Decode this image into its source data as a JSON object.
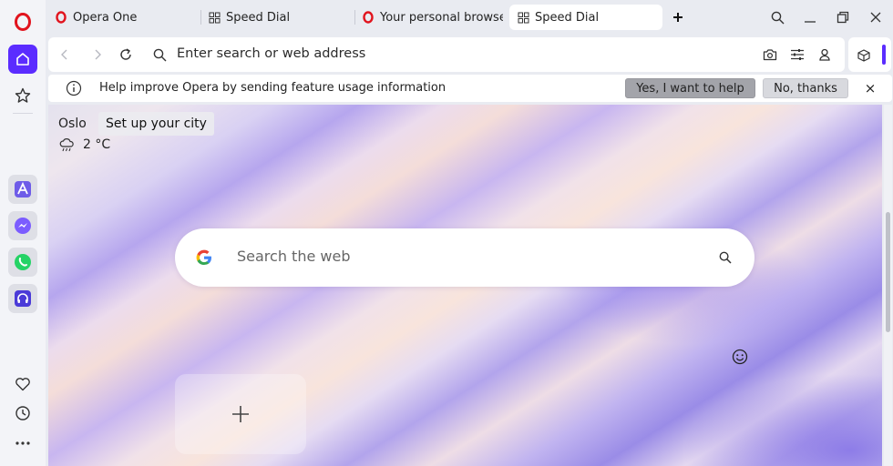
{
  "tabs": [
    {
      "title": "Opera One",
      "icon": "opera-icon"
    },
    {
      "title": "Speed Dial",
      "icon": "speed-dial-icon"
    },
    {
      "title": "Your personal browser",
      "icon": "opera-icon"
    },
    {
      "title": "Speed Dial",
      "icon": "speed-dial-icon",
      "active": true
    }
  ],
  "address_bar": {
    "placeholder": "Enter search or web address"
  },
  "infobar": {
    "message": "Help improve Opera by sending feature usage information",
    "accept_label": "Yes, I want to help",
    "decline_label": "No, thanks",
    "close_label": "×"
  },
  "weather": {
    "city": "Oslo",
    "tooltip": "Set up your city",
    "temperature": "2 °C",
    "icon": "rain-cloud-icon"
  },
  "search": {
    "placeholder": "Search the web",
    "engine_icon": "google-logo"
  },
  "speed_dial": {
    "add_icon": "plus-icon"
  },
  "colors": {
    "accent": "#5b2cff",
    "opera_red": "#e1141e",
    "sidebar_bg": "#f3f4f8"
  }
}
